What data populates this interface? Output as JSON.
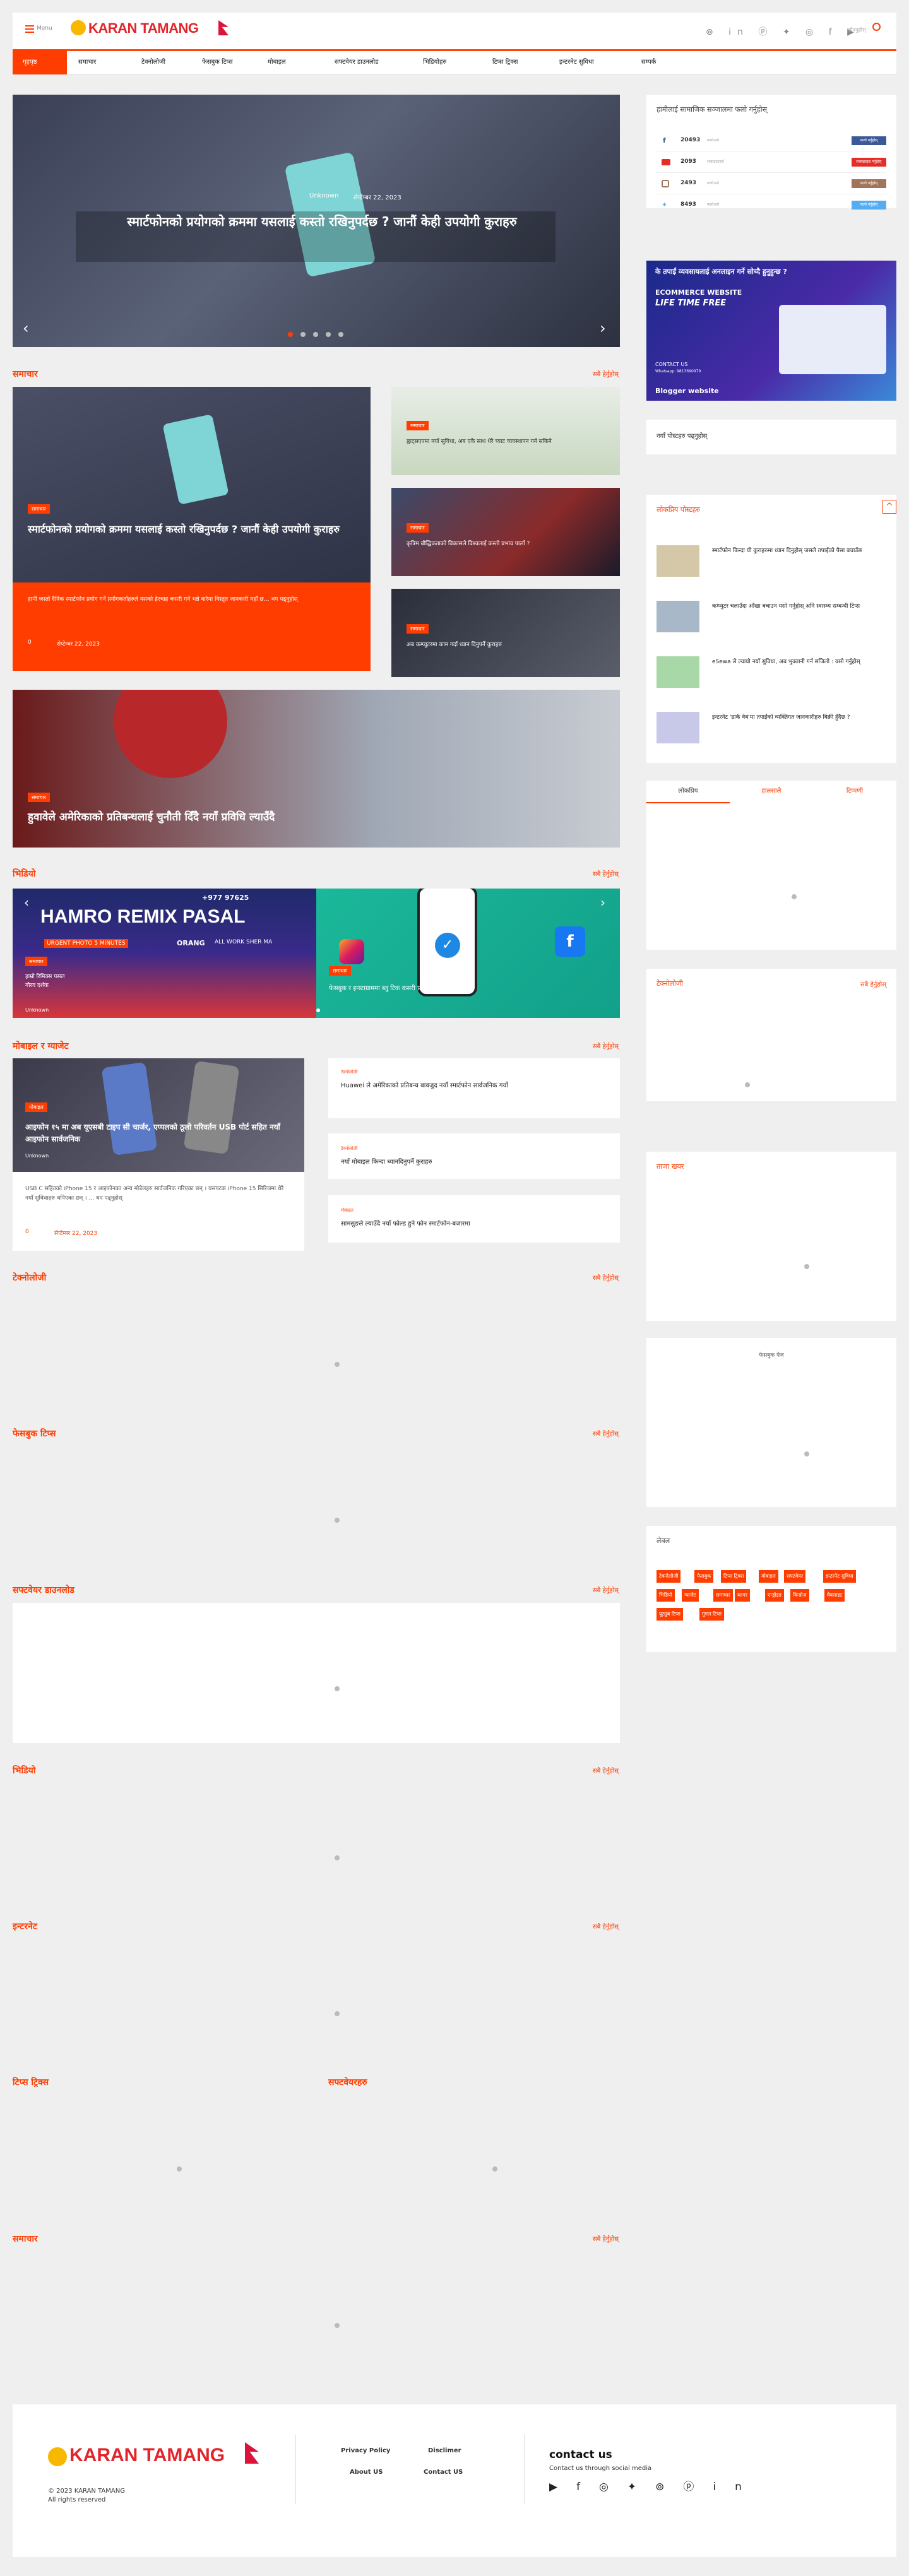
{
  "header": {
    "logo": "KARAN TAMANG",
    "menu_label": "Menu",
    "search_placeholder": "खोज्नुहोस्",
    "social_icons": [
      "reddit-icon",
      "linkedin-icon",
      "pinterest-icon",
      "twitter-icon",
      "instagram-icon",
      "facebook-icon",
      "youtube-icon"
    ]
  },
  "nav": [
    "गृहपृष्ठ",
    "समाचार",
    "टेक्नोलोजी",
    "फेसबुक टिप्स",
    "मोबाइल",
    "सफ्टवेयर डाउनलोड",
    "भिडियोहरु",
    "टिप्स ट्रिक्स",
    "इन्टरनेट सुविधा",
    "सम्पर्क"
  ],
  "hero": {
    "title": "स्मार्टफोनको प्रयोगको क्रममा यसलाई कस्तो रखिनुपर्दछ ? जानौं केही उपयोगी कुराहरु",
    "author": "Unknown",
    "date": "सेप्टेम्बर 22, 2023"
  },
  "section_news": {
    "title": "समाचार",
    "view_all": "सबै हेर्नुहोस्",
    "lead": {
      "badge": "समाचार",
      "title": "स्मार्टफोनको प्रयोगको क्रममा यसलाई कस्तो रखिनुपर्दछ ? जानौं केही उपयोगी कुराहरु",
      "excerpt": "हामी जस्तो दैनिक स्मार्टफोन प्रयोग गर्ने प्रयोगकर्ताहरुले यसको हेरचाह कसरी गर्ने भन्ने बारेमा विस्तृत जानकारी यहाँ छ… थप पढ्नुहोस्",
      "comments": "0",
      "date": "सेप्टेम्बर 22, 2023"
    },
    "side": [
      {
        "badge": "समाचार",
        "title": "ह्वाट्सएपमा नयाँ सुविधा, अब एकै साथ धेरै च्याट व्यवस्थापन गर्न सकिने"
      },
      {
        "badge": "समाचार",
        "title": "कृत्रिम बौद्धिकताको विकासले विश्वलाई कस्तो प्रभाव पार्ला ?"
      },
      {
        "badge": "समाचार",
        "title": "अब कम्प्युटरमा काम गर्दा ध्यान दिनुपर्ने कुराहरु"
      }
    ],
    "wide": {
      "badge": "समाचार",
      "title": "हुवावेले अमेरिकाको प्रतिबन्धलाई चुनौती दिँदै नयाँ प्रविधि ल्याउँदै"
    }
  },
  "section_two": {
    "title": "भिडियो",
    "view_all": "सबै हेर्नुहोस्",
    "slides": [
      {
        "badge": "समाचार",
        "title": "हाम्रो रिमिक्स पसल",
        "sub": "गौरव दर्शक",
        "author": "Unknown"
      },
      {
        "badge": "समाचार",
        "title": "फेसबुक र इन्स्टाग्राममा ब्लु टिक कसरी प्राप्त गर्ने ?"
      }
    ],
    "banner": "HAMRO REMIX PASAL",
    "phone": "+977 97625",
    "urgent": "URGENT PHOTO 5 MINUTES",
    "brand": "ORANG",
    "all_work": "ALL WORK SHER MA"
  },
  "section_mobile": {
    "title": "मोबाइल र ग्याजेट",
    "view_all": "सबै हेर्नुहोस्",
    "lead": {
      "badge": "मोबाइल",
      "title": "आइफोन १५ मा अब यूएसबी टाइप सी चार्जर, एप्पलको ठूलो परिवर्तन USB पोर्ट सहित नयाँ आइफोन सार्वजनिक",
      "author": "Unknown",
      "excerpt": "USB C सहितको iPhone 15 र आइफोनका अन्य मोडेलहरु सार्वजनिक गरिएका छन् । यसपटक iPhone 15 सिरिजमा धेरै नयाँ सुविधाहरु थपिएका छन् । ... थप पढ्नुहोस्",
      "comments": "0",
      "date": "सेप्टेम्बर 22, 2023"
    },
    "list": [
      {
        "cat": "टेक्नोलोजी",
        "title": "Huawei ले अमेरिकाको प्रतिबन्ध बावजुद नयाँ स्मार्टफोन सार्वजनिक गर्यो"
      },
      {
        "cat": "टेक्नोलोजी",
        "title": "नयाँ मोबाइल किन्दा ध्यानदिनुपर्ने कुराहरु"
      },
      {
        "cat": "मोबाइल",
        "title": "सामसुङले ल्याउँदै नयाँ फोल्ड हुने फोन स्मार्टफोन-बजारमा"
      }
    ]
  },
  "empty_sections": [
    {
      "title": "टेक्नोलोजी",
      "view_all": "सबै हेर्नुहोस्"
    },
    {
      "title": "फेसबुक टिप्स",
      "view_all": "सबै हेर्नुहोस्"
    },
    {
      "title": "सफ्टवेयर डाउनलोड",
      "view_all": "सबै हेर्नुहोस्"
    },
    {
      "title": "भिडियो",
      "view_all": "सबै हेर्नुहोस्"
    },
    {
      "title": "इन्टरनेट",
      "view_all": "सबै हेर्नुहोस्"
    }
  ],
  "dual_section": {
    "left": "टिप्स ट्रिक्स",
    "right": "सफ्टवेयरहरु"
  },
  "last_section": {
    "title": "समाचार",
    "view_all": "सबै हेर्नुहोस्"
  },
  "sidebar": {
    "social_title": "हामीलाई सामाजिक सञ्जालमा फलो गर्नुहोस्",
    "social": [
      {
        "count": "20493",
        "label": "फलोअर्स",
        "btn": "फलो गर्नुहोस्",
        "color": "#3b5998",
        "icon": "facebook-icon"
      },
      {
        "count": "2093",
        "label": "सब्सक्राइबर्स",
        "btn": "सब्सक्राइब गर्नुहोस्",
        "color": "#e52d27",
        "icon": "youtube-icon"
      },
      {
        "count": "2493",
        "label": "फलोअर्स",
        "btn": "फलो गर्नुहोस्",
        "color": "#a1755c",
        "icon": "instagram-icon"
      },
      {
        "count": "8493",
        "label": "फलोअर्स",
        "btn": "फलो गर्नुहोस्",
        "color": "#55acee",
        "icon": "twitter-icon"
      }
    ],
    "ad": {
      "headline": "के तपाईं व्यवसायलाई अनलाइन गर्ने सोच्दै हुनुहुन्छ ?",
      "title": "ECOMMERCE WEBSITE",
      "lifetime": "LIFE TIME FREE",
      "contact": "CONTACT US",
      "phone": "Whatsapp: 9813690979",
      "footer": "Blogger website"
    },
    "recent_posts": "नयाँ पोस्टहरु पढ्नुहोस्",
    "popular_title": "लोकप्रिय पोस्टहरु",
    "popular": [
      {
        "title": "स्मार्टफोन किन्दा यी कुराहरुमा ध्यान दिनुहोस् जसले तपाईंको पैसा बचाउँछ"
      },
      {
        "title": "कम्प्युटर चलाउँदा आँखा बचाउन यसो गर्नुहोस् अनि स्वास्थ्य सम्बन्धी टिप्स"
      },
      {
        "title": "eSewa ले ल्यायो नयाँ सुविधा, अब भुक्तानी गर्न सजिलो : यसो गर्नुहोस्"
      },
      {
        "title": "इन्टरनेट 'डार्क वेब'मा तपाईंको व्यक्तिगत जानकारीहरु बिक्री हुँदैछ ?"
      }
    ],
    "tabs": [
      "लोकप्रिय",
      "हालसालै",
      "टिप्पणी"
    ],
    "w1_title": "टेक्नोलोजी",
    "w1_viewall": "सबै हेर्नुहोस्",
    "w2_title": "ताजा खबर",
    "w3_title": "फेसबुक पेज",
    "labels_title": "लेबल",
    "labels": [
      "टेक्नोलोजी",
      "फेसबुक",
      "टिप्स ट्रिक्स",
      "मोबाइल",
      "सफ्टवेयर",
      "इन्टरनेट सुविधा",
      "भिडियो",
      "ग्याजेट",
      "समाचार",
      "ब्लगर",
      "एन्ड्रोइड",
      "विन्डोज",
      "वेबसाइट",
      "यूट्युब टिप्स",
      "गुगल टिप्स"
    ]
  },
  "footer": {
    "logo": "KARAN TAMANG",
    "copyright": "© 2023 KARAN TAMANG",
    "rights": "All rights reserved",
    "links": [
      "Privacy Policy",
      "Disclimer",
      "About US",
      "Contact US"
    ],
    "contact_title": "contact us",
    "contact_sub": "Contact us through social media",
    "icons": [
      "youtube-icon",
      "facebook-icon",
      "instagram-icon",
      "twitter-icon",
      "reddit-icon",
      "pinterest-icon",
      "linkedin-icon"
    ]
  },
  "colors": {
    "accent": "#ff3d00",
    "nav_border": "#ff4500"
  }
}
